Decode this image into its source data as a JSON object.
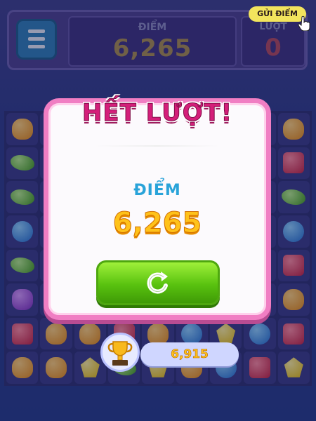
{
  "header": {
    "score_label": "ĐIỂM",
    "score_value": "6,265",
    "moves_label": "LƯỢT",
    "moves_value": "0",
    "send_label": "GỬI ĐIỂM"
  },
  "board": {
    "rows": [
      [
        "orange",
        "orange",
        "orange",
        "orange",
        "orange",
        "orange",
        "red",
        "red",
        "orange"
      ],
      [
        "green",
        "green",
        "green",
        "green",
        "green",
        "green",
        "red",
        "red",
        "red"
      ],
      [
        "green",
        "green",
        "green",
        "green",
        "green",
        "green",
        "yellow",
        "yellow",
        "green"
      ],
      [
        "blue",
        "blue",
        "blue",
        "blue",
        "blue",
        "blue",
        "orange",
        "orange",
        "blue"
      ],
      [
        "green",
        "green",
        "green",
        "green",
        "green",
        "green",
        "red",
        "red",
        "red"
      ],
      [
        "purple",
        "purple",
        "purple",
        "purple",
        "purple",
        "purple",
        "yellow",
        "yellow",
        "orange"
      ],
      [
        "red",
        "orange",
        "orange",
        "red",
        "orange",
        "blue",
        "yellow",
        "blue",
        "red"
      ],
      [
        "orange",
        "orange",
        "yellow",
        "green",
        "yellow",
        "orange",
        "blue",
        "red",
        "yellow"
      ]
    ]
  },
  "dialog": {
    "title": "HẾT LƯỢT!",
    "result_label": "ĐIỂM",
    "result_value": "6,265",
    "replay_icon": "replay-icon"
  },
  "best": {
    "value": "6,915",
    "trophy_label": "BEST",
    "icon": "trophy-icon"
  },
  "colors": {
    "dialog_border": "#f07ec3",
    "title": "#d41f7a",
    "score_blue": "#29a3d9",
    "score_gold": "#ffc21a",
    "replay_green": "#59c20f"
  }
}
